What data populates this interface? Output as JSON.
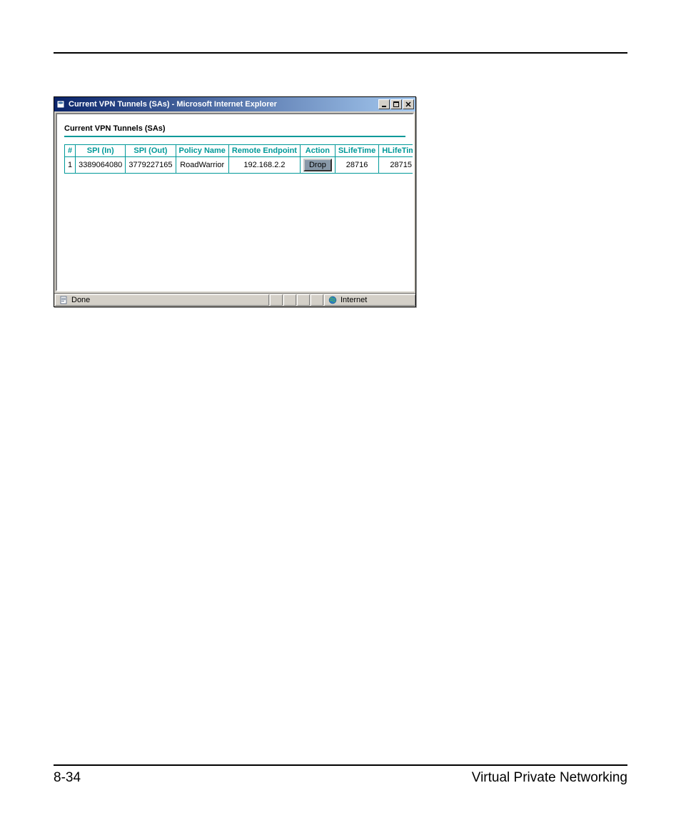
{
  "window": {
    "title": "Current VPN Tunnels (SAs) - Microsoft Internet Explorer"
  },
  "content": {
    "heading": "Current VPN Tunnels (SAs)",
    "headers": {
      "num": "#",
      "spi_in": "SPI (In)",
      "spi_out": "SPI (Out)",
      "policy_name": "Policy Name",
      "remote_endpoint": "Remote Endpoint",
      "action": "Action",
      "slifetime": "SLifeTime",
      "hlifetime": "HLifeTime"
    },
    "rows": [
      {
        "num": "1",
        "spi_in": "3389064080",
        "spi_out": "3779227165",
        "policy_name": "RoadWarrior",
        "remote_endpoint": "192.168.2.2",
        "action_label": "Drop",
        "slifetime": "28716",
        "hlifetime": "28715"
      }
    ]
  },
  "statusbar": {
    "status_text": "Done",
    "zone_text": "Internet"
  },
  "footer": {
    "page_number": "8-34",
    "section_title": "Virtual Private Networking"
  }
}
